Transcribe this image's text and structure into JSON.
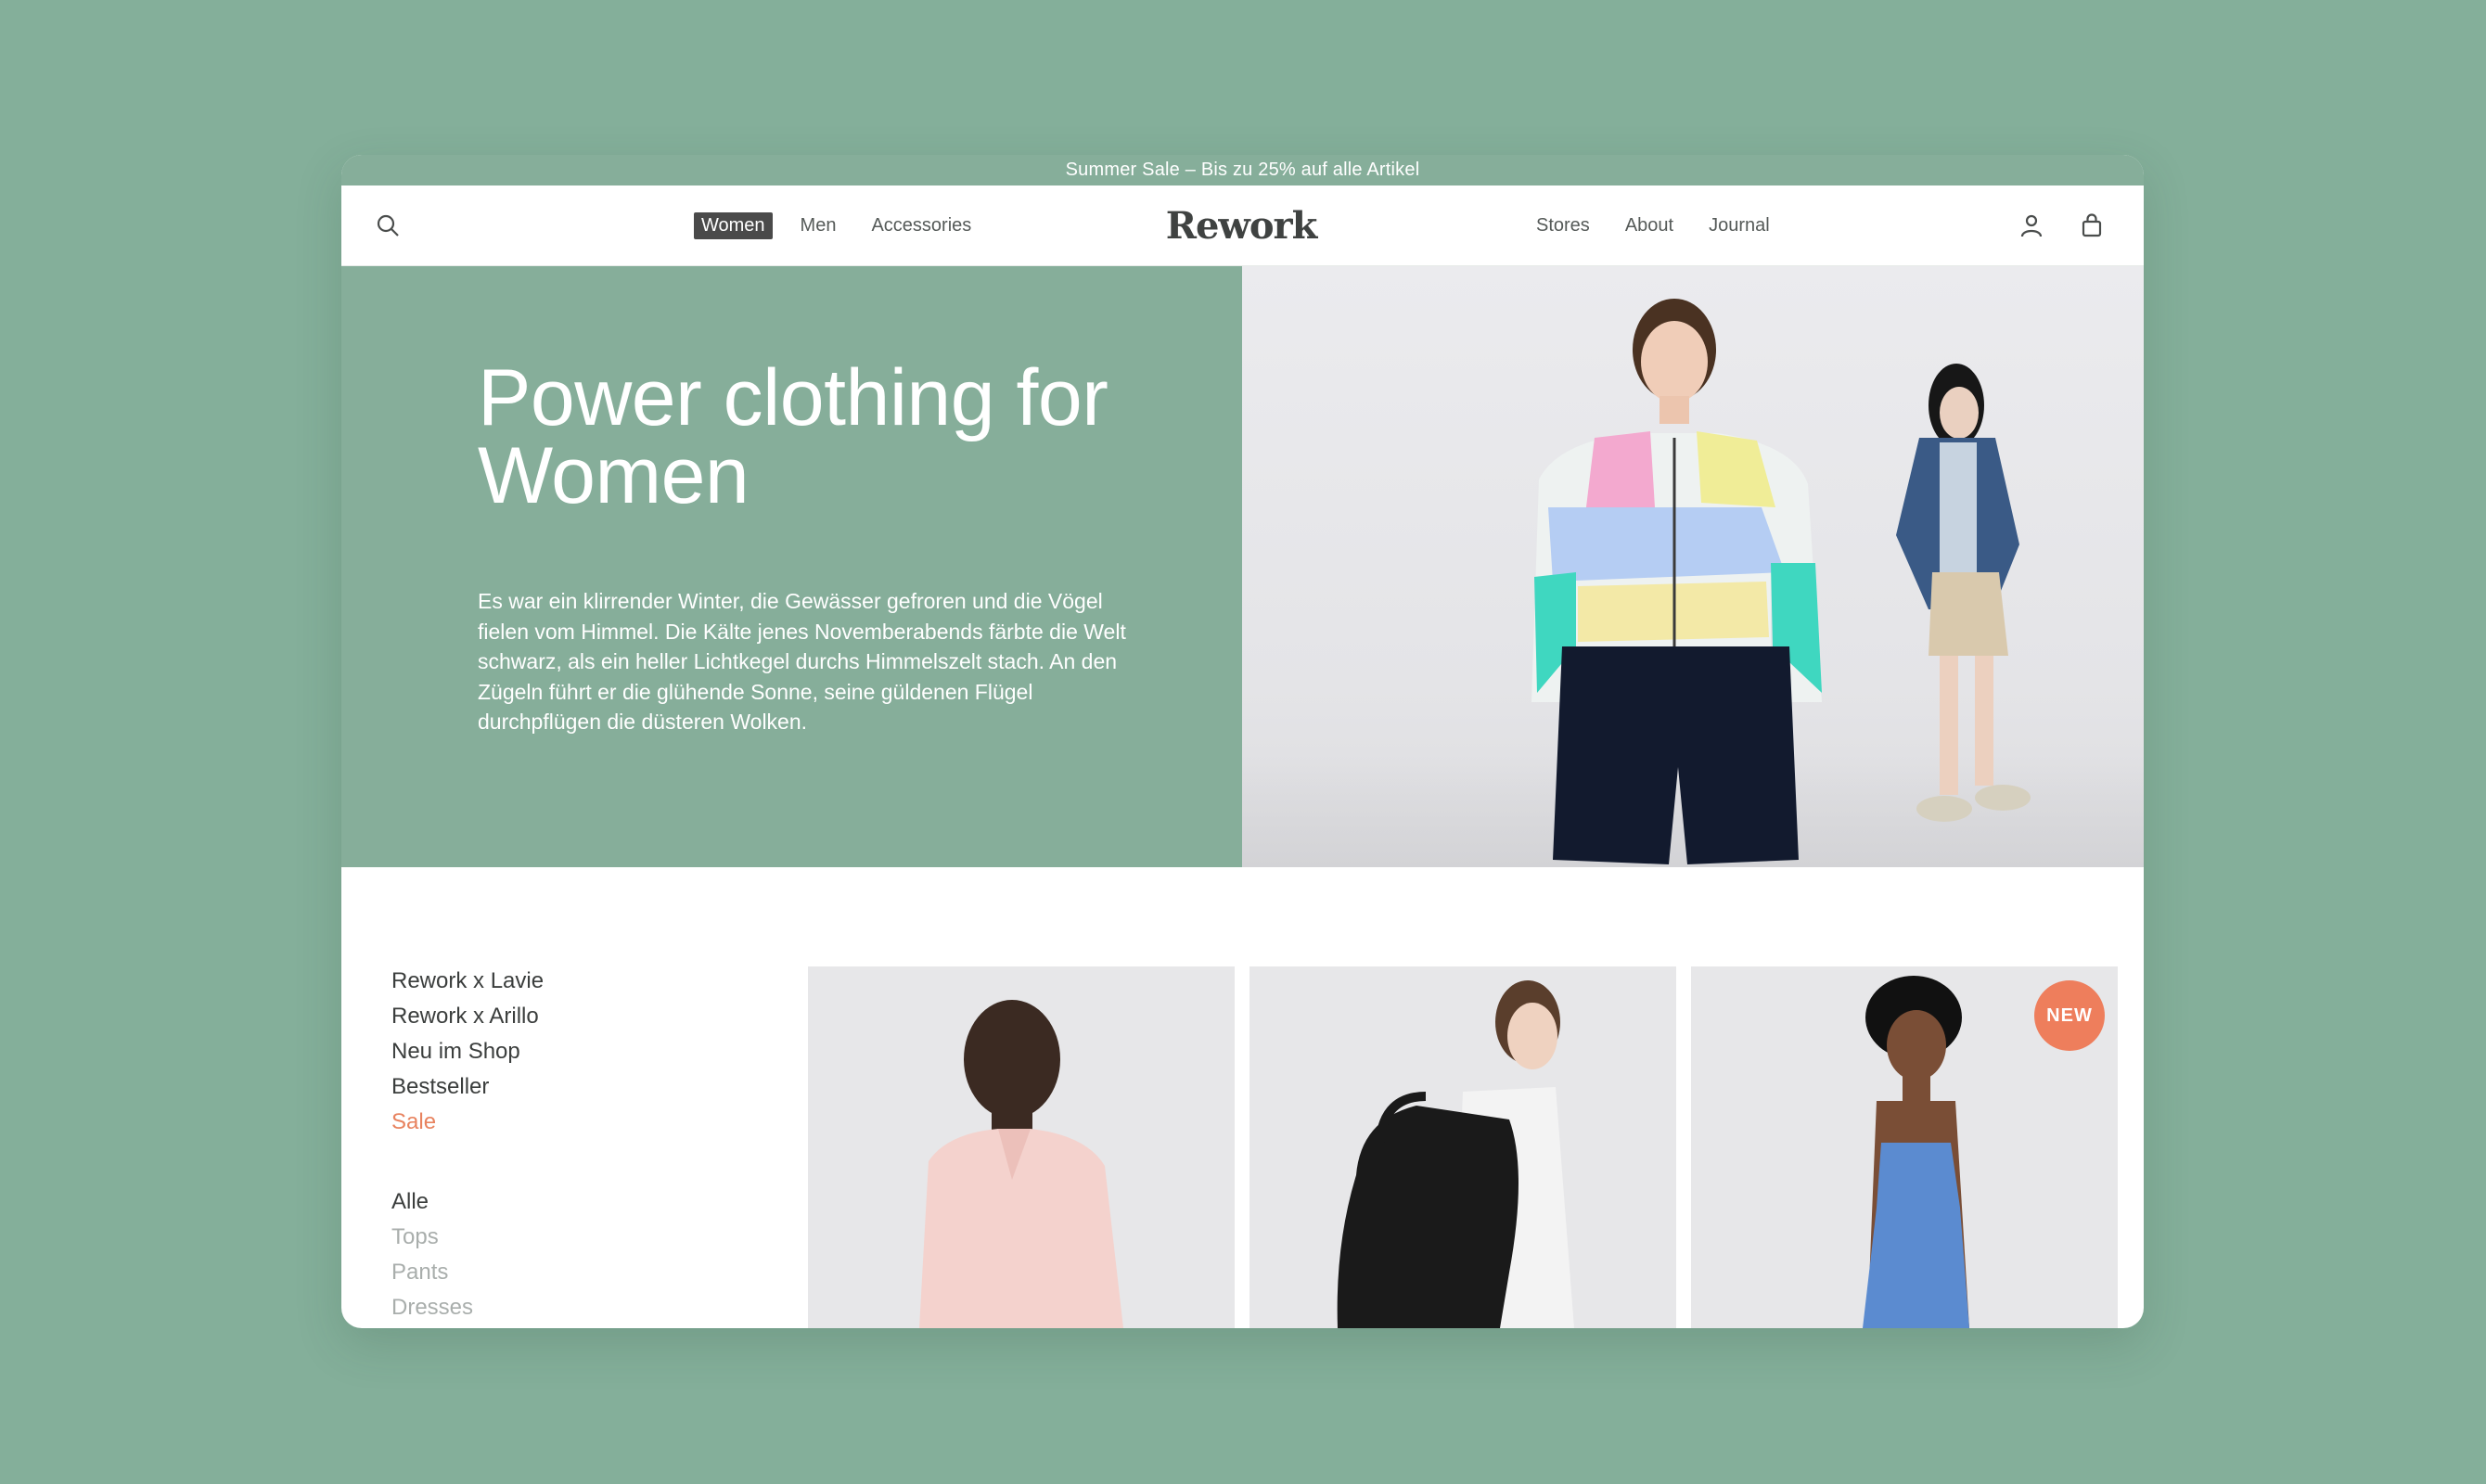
{
  "announcement": "Summer Sale – Bis zu 25% auf alle Artikel",
  "nav_left": [
    {
      "label": "Women",
      "active": true
    },
    {
      "label": "Men",
      "active": false
    },
    {
      "label": "Accessories",
      "active": false
    }
  ],
  "logo": "Rework",
  "nav_right": [
    {
      "label": "Stores"
    },
    {
      "label": "About"
    },
    {
      "label": "Journal"
    }
  ],
  "icons": {
    "search": "search-icon",
    "account": "user-icon",
    "cart": "shopping-bag-icon"
  },
  "hero": {
    "title": "Power clothing for Women",
    "text": "Es war ein klirrender Winter, die Gewässer gefroren und die Vögel fielen vom Himmel. Die Kälte jenes Novemberabends färbte die Welt schwarz, als ein heller Lichtkegel durchs Himmelszelt stach. An den Zügeln führt er die glühende Sonne, seine güldenen Flügel durchpflügen die düsteren Wolken."
  },
  "sidebar": {
    "collections": [
      "Rework x Lavie",
      "Rework x Arillo",
      "Neu im Shop",
      "Bestseller",
      "Sale"
    ],
    "categories": [
      "Alle",
      "Tops",
      "Pants",
      "Dresses"
    ]
  },
  "products": [
    {
      "badge": ""
    },
    {
      "badge": ""
    },
    {
      "badge": "NEW"
    }
  ],
  "colors": {
    "background": "#84af9a",
    "hero_green": "#86ae9a",
    "sale_accent": "#e8835f",
    "badge": "#ee7e5c",
    "active_nav": "#4a4a4a"
  }
}
